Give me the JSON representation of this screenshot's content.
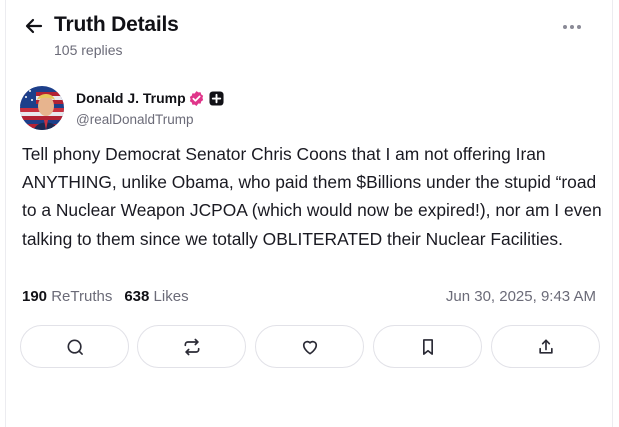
{
  "header": {
    "title": "Truth Details",
    "subtitle": "105 replies",
    "back_icon": "arrow-left-icon",
    "more_icon": "more-horizontal-icon"
  },
  "post": {
    "author_name": "Donald J. Trump",
    "handle": "@realDonaldTrump",
    "verified_icon": "verified-badge-icon",
    "plus_icon": "plus-badge-icon",
    "verified_color": "#e0358a",
    "text": "Tell phony Democrat Senator Chris Coons that I am not offering Iran ANYTHING, unlike Obama, who paid them $Billions under the stupid “road to a Nuclear Weapon JCPOA (which would now be expired!), nor am I even talking to them since we totally OBLITERATED their Nuclear Facilities.",
    "retruths_count": "190",
    "retruths_label": "ReTruths",
    "likes_count": "638",
    "likes_label": "Likes",
    "timestamp": "Jun 30, 2025, 9:43 AM"
  },
  "actions": [
    {
      "icon": "reply-icon"
    },
    {
      "icon": "retruth-icon"
    },
    {
      "icon": "like-heart-icon"
    },
    {
      "icon": "bookmark-icon"
    },
    {
      "icon": "share-icon"
    }
  ]
}
